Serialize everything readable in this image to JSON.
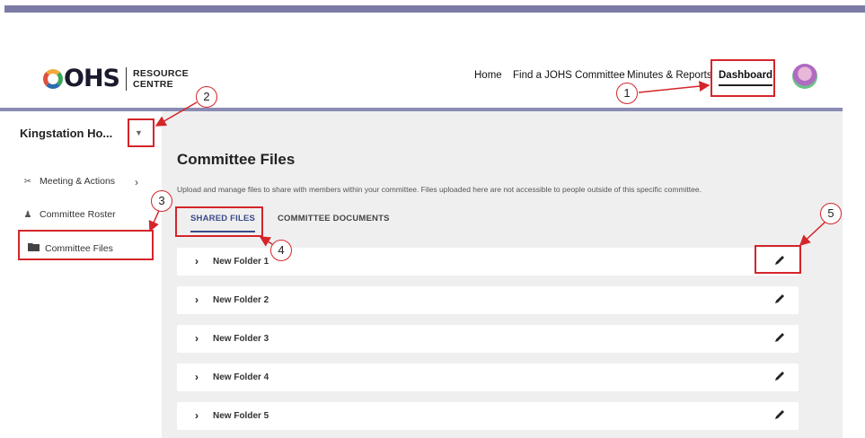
{
  "logo": {
    "brand": "OHS",
    "line1": "RESOURCE",
    "line2": "CENTRE"
  },
  "nav": {
    "home": "Home",
    "find": "Find a JOHS Committee",
    "minutes": "Minutes & Reports",
    "dashboard": "Dashboard"
  },
  "sidebar": {
    "selector": "Kingstation Ho...",
    "items": [
      {
        "label": "Meeting & Actions",
        "icon": "handshake-icon"
      },
      {
        "label": "Committee Roster",
        "icon": "people-icon"
      },
      {
        "label": "Committee Files",
        "icon": "folder-icon"
      }
    ]
  },
  "main": {
    "title": "Committee Files",
    "description": "Upload and manage files to share with members within your committee. Files uploaded here are not accessible to people outside of this specific committee.",
    "tabs": [
      {
        "label": "SHARED FILES"
      },
      {
        "label": "COMMITTEE DOCUMENTS"
      }
    ],
    "folders": [
      {
        "name": "New Folder 1"
      },
      {
        "name": "New Folder 2"
      },
      {
        "name": "New Folder 3"
      },
      {
        "name": "New Folder 4"
      },
      {
        "name": "New Folder 5"
      }
    ]
  },
  "annotations": [
    "1",
    "2",
    "3",
    "4",
    "5"
  ],
  "colors": {
    "accent": "#3a4a8a",
    "annotation": "#d4252a",
    "topbar": "#7b7ba6",
    "content_bg": "#efefef"
  }
}
